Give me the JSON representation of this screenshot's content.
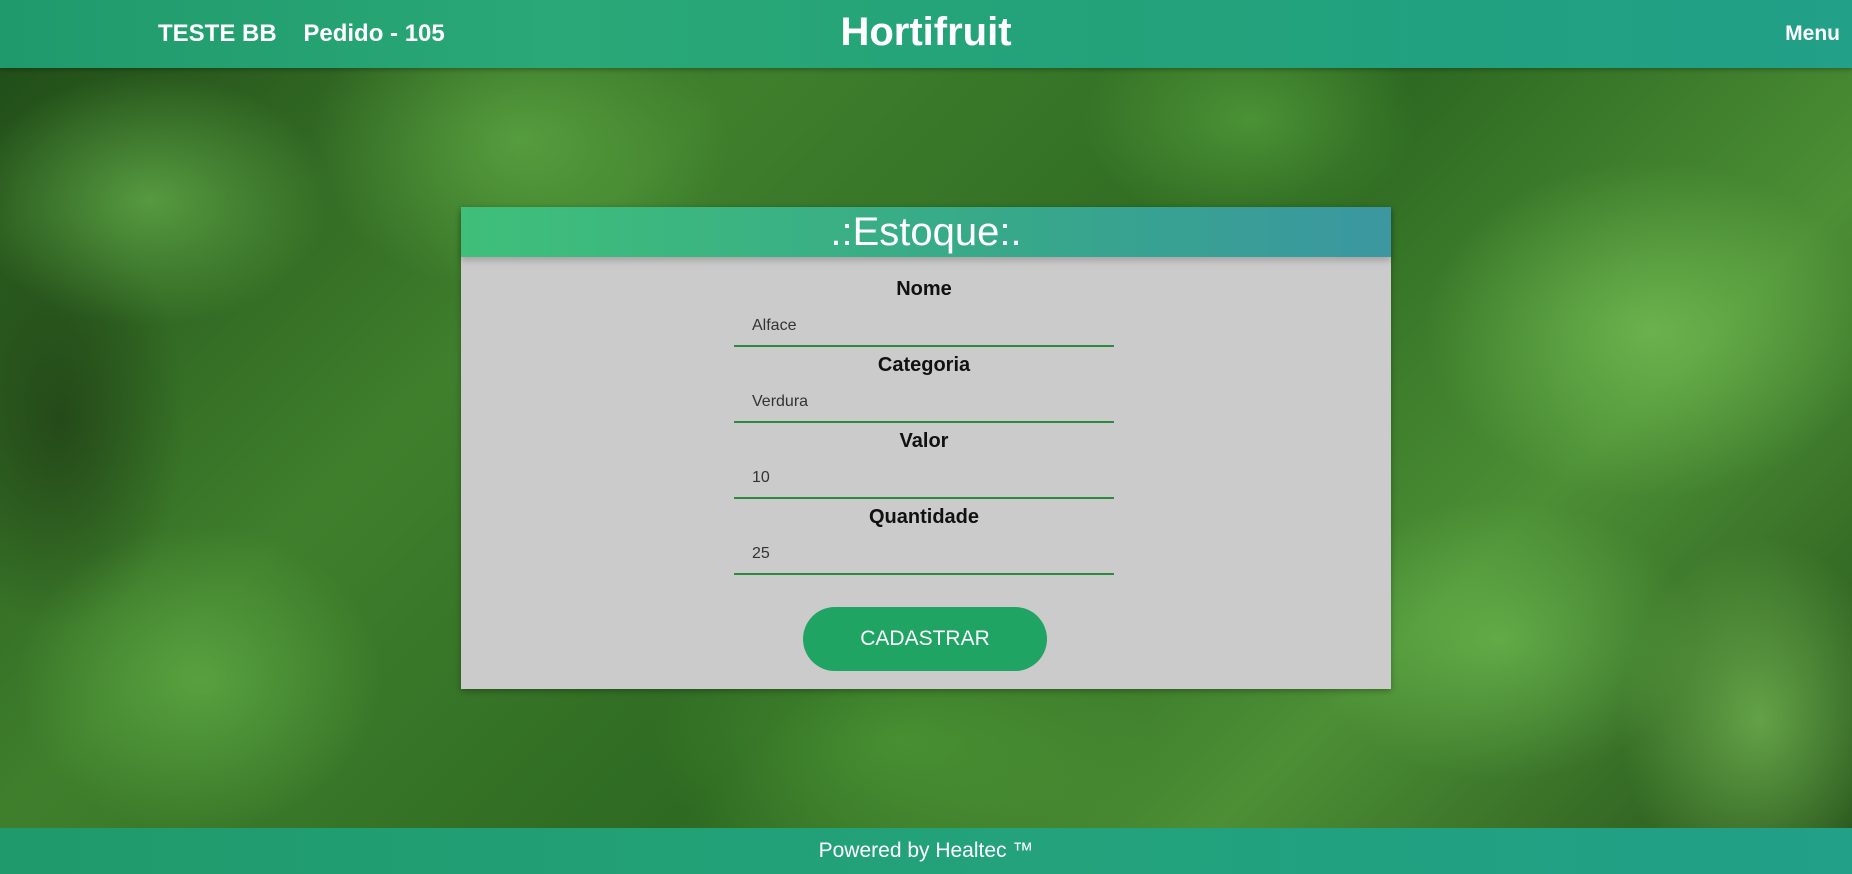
{
  "header": {
    "store_name": "TESTE BB",
    "order_label": "Pedido - 105",
    "title": "Hortifruit",
    "menu_label": "Menu"
  },
  "card": {
    "title": ".:Estoque:.",
    "fields": [
      {
        "label": "Nome",
        "value": "Alface"
      },
      {
        "label": "Categoria",
        "value": "Verdura"
      },
      {
        "label": "Valor",
        "value": "10"
      },
      {
        "label": "Quantidade",
        "value": "25"
      }
    ],
    "submit_label": "CADASTRAR"
  },
  "footer": {
    "text": "Powered by Healtec ™"
  },
  "colors": {
    "header_bar": "#23a27a",
    "card_background": "#cbcbcb",
    "button": "#1fa463",
    "input_underline": "#2e8b3e"
  }
}
